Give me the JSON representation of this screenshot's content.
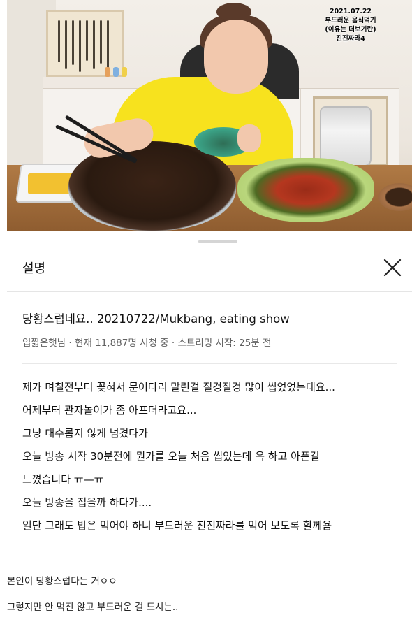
{
  "video_overlay": {
    "date": "2021.07.22",
    "line1": "부드러운 음식먹기",
    "line2": "(이유는 더보기란)",
    "line3": "진진짜라4"
  },
  "sheet": {
    "title": "설명",
    "close_icon": "close-icon",
    "video_title": "당황스럽네요..  20210722/Mukbang, eating show",
    "meta": "입짧은햇님 · 현재 11,887명 시청 중 · 스트리밍 시작: 25분 전",
    "description_lines": [
      "제가 며칠전부터 꽂혀서 문어다리 말린걸 질겅질겅 많이 씹었었는데요...",
      "어제부터 관자놀이가 좀 아프더라고요...",
      "그냥 대수롭지 않게 넘겼다가",
      "오늘 방송 시작 30분전에 뭔가를 오늘 처음 씹었는데 윽 하고 아픈걸",
      "느꼈습니다 ㅠ—ㅠ",
      "오늘 방송을 접을까 하다가....",
      "일단 그래도 밥은 먹어야 하니 부드러운 진진짜라를 먹어 보도록 할께욤"
    ]
  },
  "post": {
    "line1": "본인이 당황스럽다는 거ㅇㅇ",
    "line2": "그렇지만 안 먹진 않고 부드러운 걸 드시는.."
  }
}
